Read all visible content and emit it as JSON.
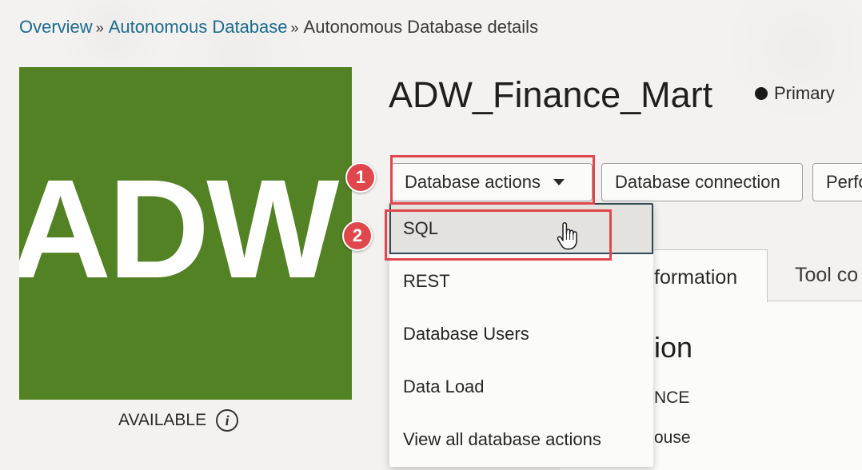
{
  "breadcrumb": {
    "items": [
      "Overview",
      "Autonomous Database"
    ],
    "separator": "»",
    "current": "Autonomous Database details"
  },
  "tile": {
    "text": "ADW",
    "color": "#528224"
  },
  "status": {
    "label": "AVAILABLE",
    "icon": "info-icon"
  },
  "header": {
    "title": "ADW_Finance_Mart",
    "role": "Primary"
  },
  "toolbar": {
    "actions_label": "Database actions",
    "connection_label": "Database connection",
    "perf_label": "Perfo"
  },
  "markers": [
    "1",
    "2"
  ],
  "dropdown": {
    "items": [
      "SQL",
      "REST",
      "Database Users",
      "Data Load",
      "View all database actions"
    ]
  },
  "tabs": {
    "info_label": "formation",
    "tool_label": "Tool co"
  },
  "section": {
    "heading": "ion",
    "detail_1": "NCE",
    "detail_2": "ouse"
  },
  "colors": {
    "accent_red": "#e0474c",
    "link": "#1d6b8f",
    "hover_border": "#2e4a55"
  }
}
